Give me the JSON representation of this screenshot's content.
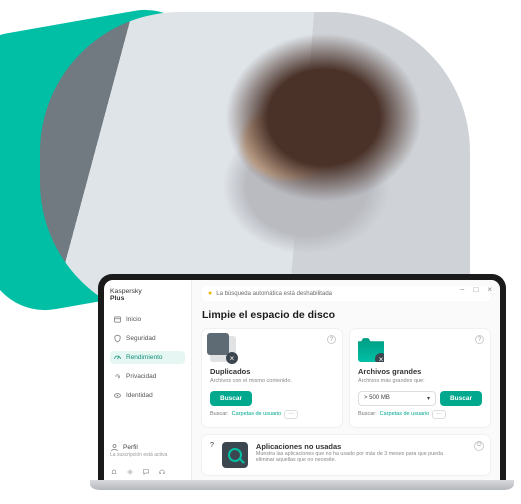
{
  "brand": {
    "line1": "Kaspersky",
    "line2": "Plus"
  },
  "nav": {
    "home": "Inicio",
    "security": "Seguridad",
    "performance": "Rendimiento",
    "privacy": "Privacidad",
    "identity": "Identidad"
  },
  "profile": {
    "title": "Perfil",
    "sub": "La suscripción está activa"
  },
  "notice": "La búsqueda automática está deshabilitada",
  "page_title": "Limpie el espacio de disco",
  "cards": {
    "dup": {
      "title": "Duplicados",
      "sub": "Archivos con el mismo contenido.",
      "btn": "Buscar",
      "search_label": "Buscar:",
      "search_link": "Carpetas de usuario"
    },
    "big": {
      "title": "Archivos grandes",
      "sub": "Archivos más grandes que:",
      "select": "> 500 MB",
      "btn": "Buscar",
      "search_label": "Buscar:",
      "search_link": "Carpetas de usuario"
    },
    "apps": {
      "title": "Aplicaciones no usadas",
      "sub": "Muestra las aplicaciones que no ha usado por más de 3 meses para que pueda eliminar aquellas que no necesite."
    }
  }
}
